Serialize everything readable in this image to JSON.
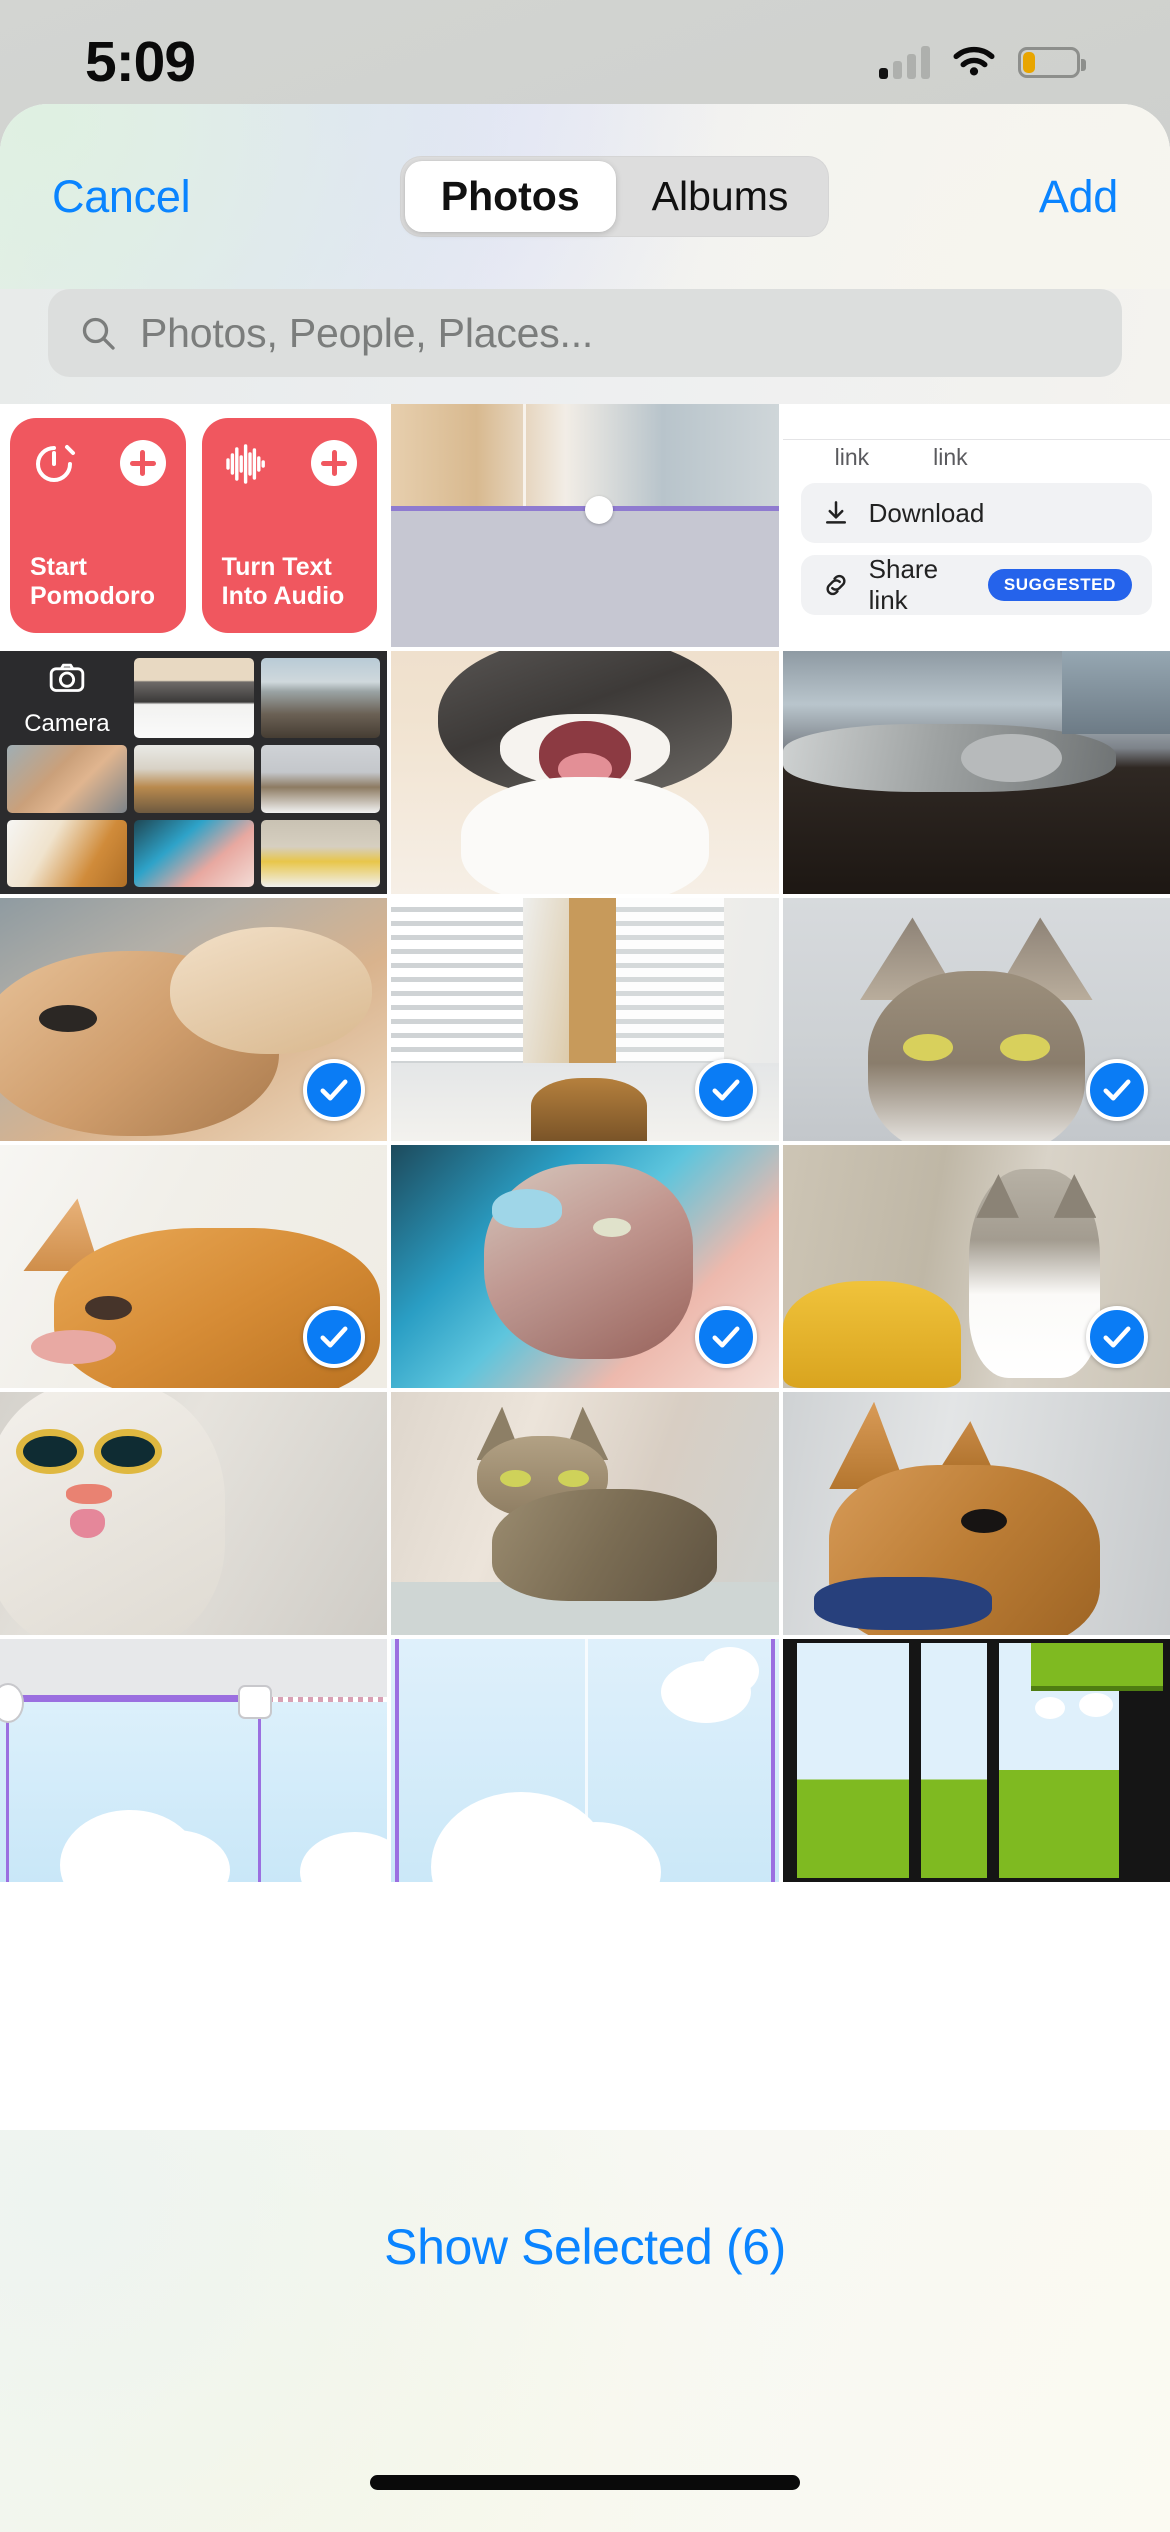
{
  "status_bar": {
    "time": "5:09",
    "signal_icon": "cellular-signal-icon",
    "signal_bars_active": 1,
    "signal_bars_total": 4,
    "wifi_icon": "wifi-icon",
    "battery_icon": "battery-icon",
    "battery_level_percent": 22,
    "battery_color": "#e8a500"
  },
  "header": {
    "cancel_label": "Cancel",
    "add_label": "Add",
    "accent_color": "#0a84ff",
    "segmented": {
      "options": [
        {
          "label": "Photos",
          "selected": true
        },
        {
          "label": "Albums",
          "selected": false
        }
      ]
    }
  },
  "search": {
    "placeholder": "Photos, People, Places...",
    "value": "",
    "icon": "search-icon"
  },
  "grid": {
    "columns": 3,
    "selection_color": "#0a7cf5",
    "check_icon": "checkmark-icon",
    "rows": [
      {
        "cells": [
          {
            "kind": "widget",
            "tiles": [
              {
                "label": "Start Pomodoro",
                "icon": "timer-icon",
                "action_icon": "plus-icon",
                "color": "#f0575f"
              },
              {
                "label": "Turn Text Into Audio",
                "icon": "waveform-icon",
                "action_icon": "plus-icon",
                "color": "#f0575f"
              }
            ],
            "selected": false
          },
          {
            "kind": "photo",
            "description": "cat-on-blanket-screenshot",
            "selected": false
          },
          {
            "kind": "screenshot",
            "links": [
              "link",
              "link"
            ],
            "rows": [
              {
                "label": "Download",
                "icon": "download-icon",
                "badge": ""
              },
              {
                "label": "Share link",
                "icon": "link-icon",
                "badge": "SUGGESTED"
              }
            ],
            "badge_color": "#2563eb",
            "selected": false
          }
        ]
      },
      {
        "cells": [
          {
            "kind": "camera-collage",
            "camera_label": "Camera",
            "camera_icon": "camera-icon",
            "selected": false
          },
          {
            "kind": "photo",
            "description": "yawning-tuxedo-cat",
            "selected": false
          },
          {
            "kind": "photo",
            "description": "tabby-cat-lying-on-windowsill",
            "selected": false
          }
        ]
      },
      {
        "cells": [
          {
            "kind": "photo",
            "description": "ginger-cat-lying-upside-down",
            "selected": true
          },
          {
            "kind": "photo",
            "description": "cat-sleeping-on-bed-by-window",
            "selected": true
          },
          {
            "kind": "photo",
            "description": "tabby-cat-portrait-grey-background",
            "selected": true
          }
        ]
      },
      {
        "cells": [
          {
            "kind": "photo",
            "description": "orange-cat-head-down",
            "selected": true
          },
          {
            "kind": "photo",
            "description": "fluffy-cat-with-butterfly-teal-light",
            "selected": true
          },
          {
            "kind": "photo",
            "description": "white-grey-cat-on-couch-yellow-pillow",
            "selected": true
          }
        ]
      },
      {
        "cells": [
          {
            "kind": "photo",
            "description": "surprised-white-cat-wide-eyes",
            "selected": false
          },
          {
            "kind": "photo",
            "description": "striped-tabby-cat-sitting",
            "selected": false
          },
          {
            "kind": "photo",
            "description": "ginger-cat-with-blue-collar",
            "selected": false
          }
        ]
      },
      {
        "cells": [
          {
            "kind": "video-editor",
            "description": "video-timeline-with-clouds",
            "selected": false
          },
          {
            "kind": "video-clouds",
            "description": "sky-clouds-video-frame",
            "selected": false
          },
          {
            "kind": "video-filmstrip",
            "description": "landscape-filmstrip-frames",
            "selected": false
          }
        ]
      }
    ]
  },
  "bottom_bar": {
    "show_selected_label": "Show Selected (6)",
    "selected_count": 6,
    "accent_color": "#0a84ff",
    "home_indicator": "home-indicator"
  }
}
